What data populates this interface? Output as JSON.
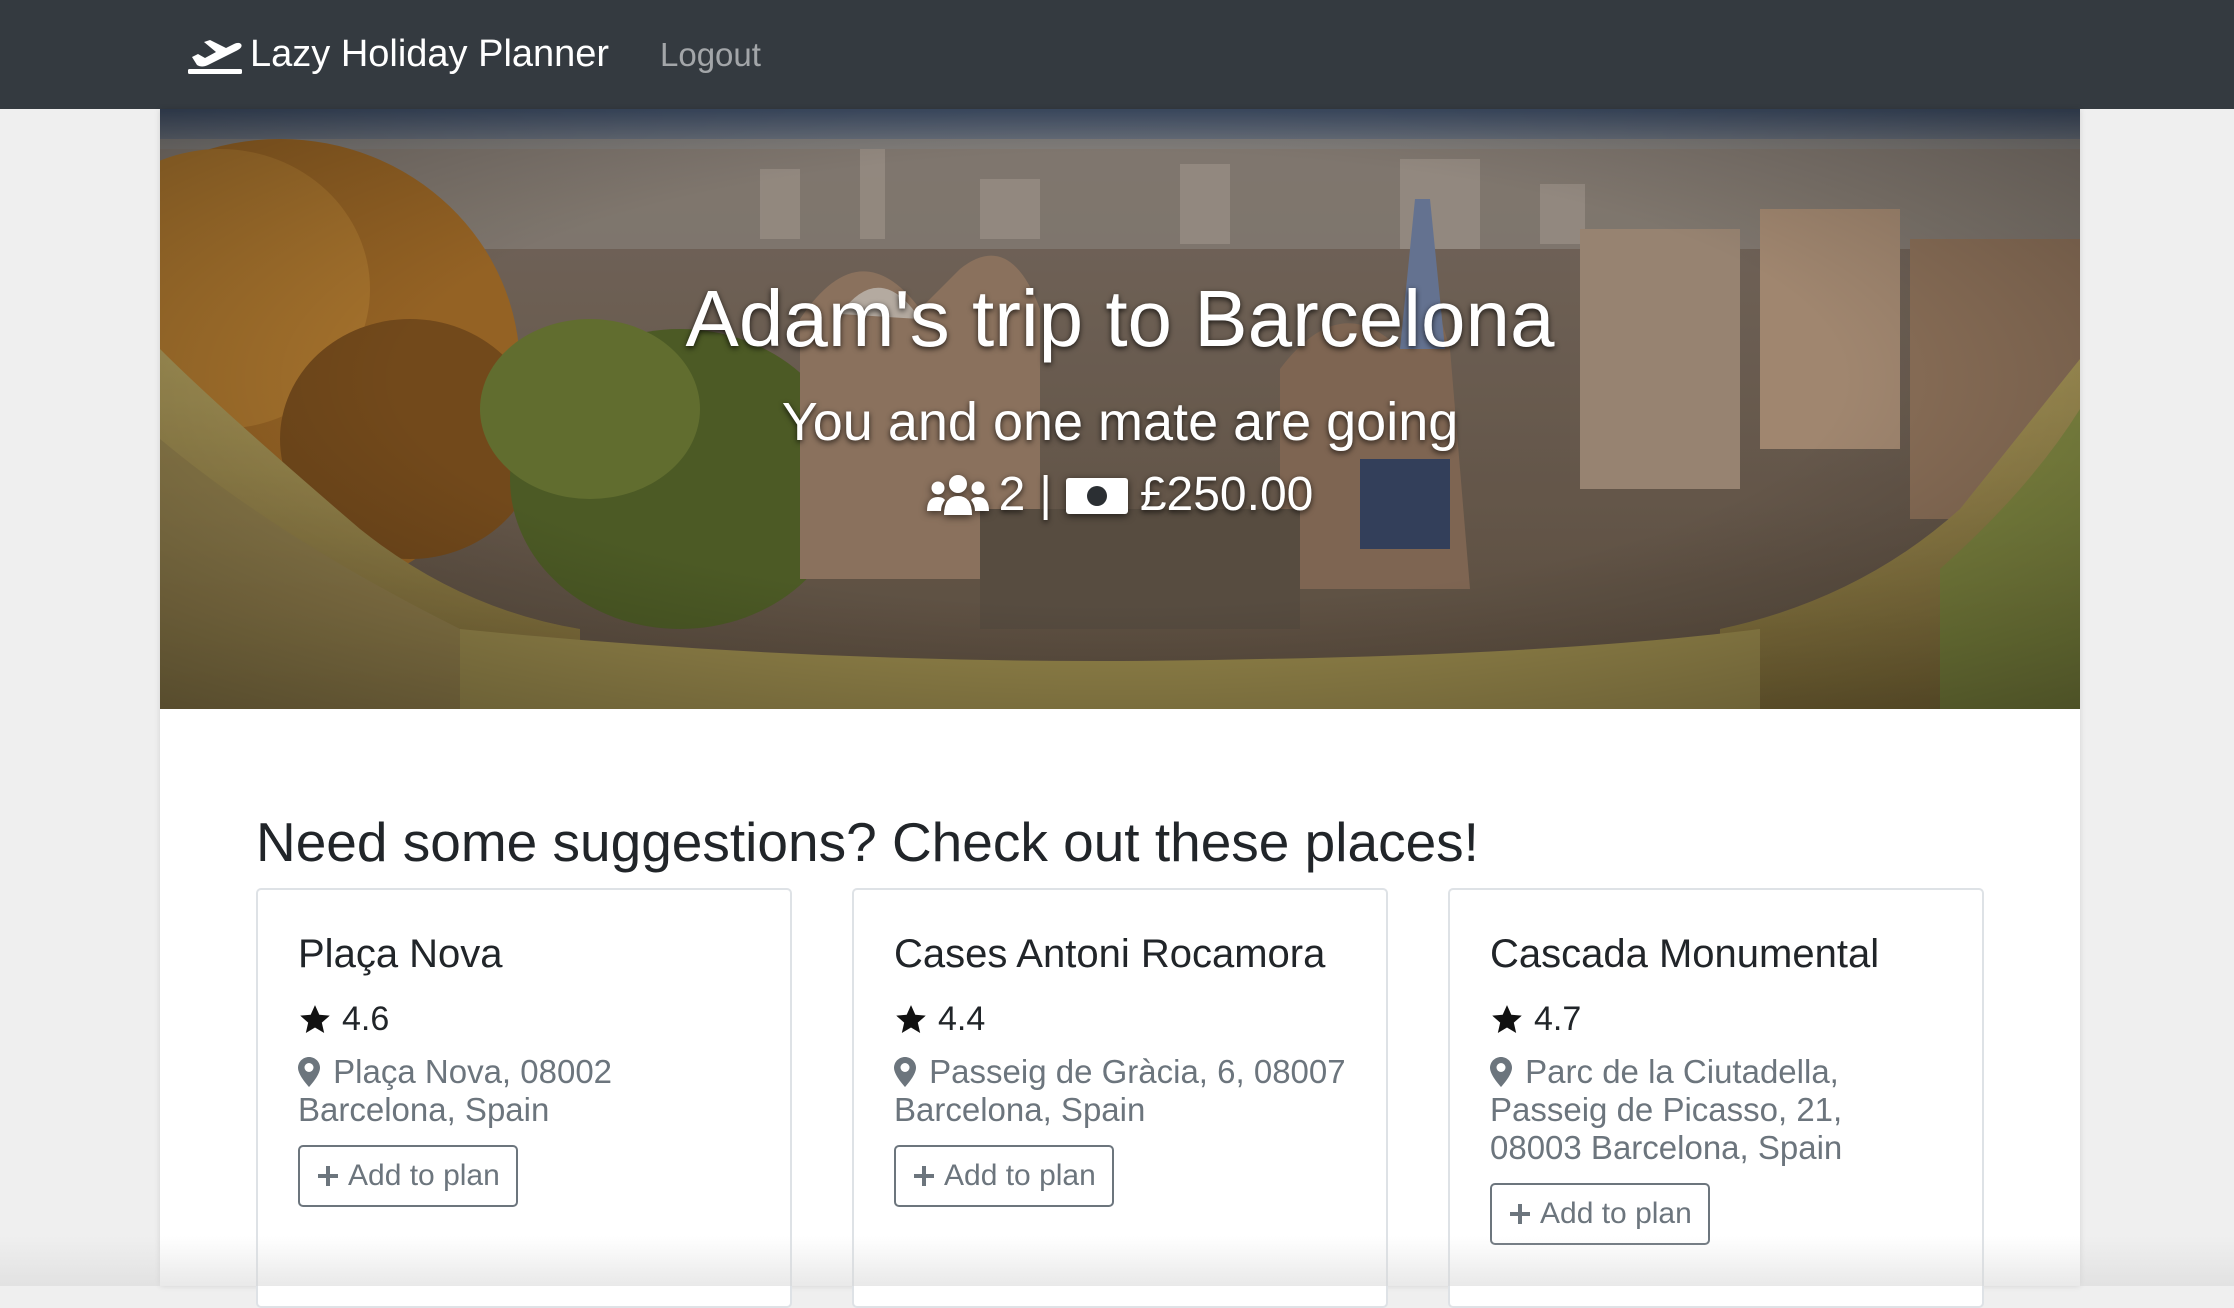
{
  "navbar": {
    "brand_icon": "plane-departure-icon",
    "brand": "Lazy Holiday Planner",
    "logout": "Logout",
    "background": "#343a40"
  },
  "hero": {
    "title": "Adam's trip to Barcelona",
    "subtitle": "You and one mate are going",
    "people_icon": "users-icon",
    "people_count": "2",
    "separator": "|",
    "money_icon": "money-bill-icon",
    "budget": "£250.00"
  },
  "suggestions": {
    "heading": "Need some suggestions? Check out these places!",
    "places": [
      {
        "name": "Plaça Nova",
        "rating": "4.6",
        "address": "Plaça Nova, 08002 Barcelona, Spain",
        "button": "Add to plan"
      },
      {
        "name": "Cases Antoni Rocamora",
        "rating": "4.4",
        "address": "Passeig de Gràcia, 6, 08007 Barcelona, Spain",
        "button": "Add to plan"
      },
      {
        "name": "Cascada Monumental",
        "rating": "4.7",
        "address": "Parc de la Ciutadella, Passeig de Picasso, 21, 08003 Barcelona, Spain",
        "button": "Add to plan"
      }
    ]
  }
}
